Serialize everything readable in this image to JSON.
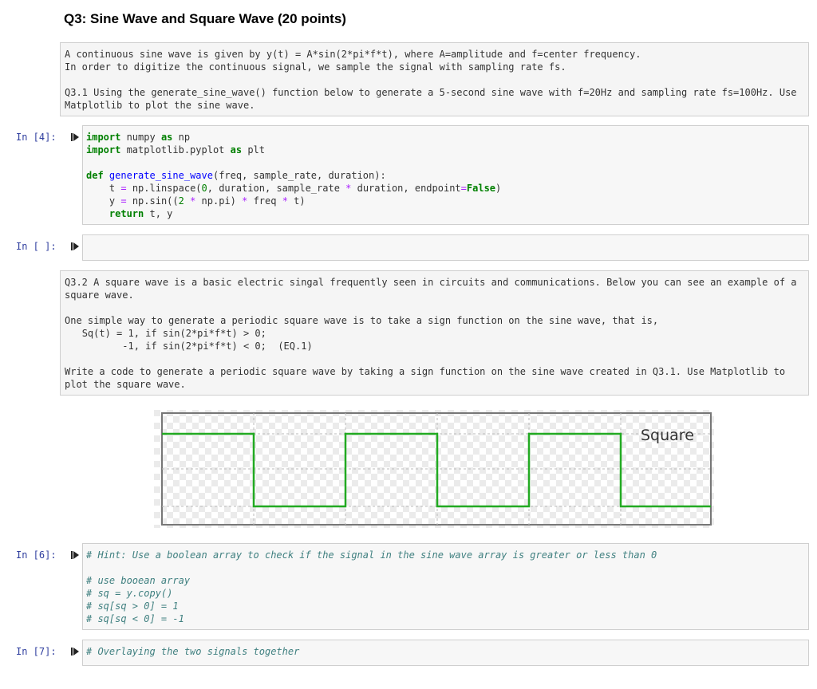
{
  "heading": "Q3: Sine Wave and Square Wave (20 points)",
  "md1": {
    "line1": "A continuous sine wave is given by y(t) = A*sin(2*pi*f*t), where A=amplitude and f=center frequency.",
    "line2": "In order to digitize the continuous signal, we sample the signal with sampling rate fs.",
    "line3": "Q3.1 Using the generate_sine_wave() function below to generate a 5-second sine wave with f=20Hz and sampling rate fs=100Hz. Use",
    "line4": "Matplotlib to plot the sine wave."
  },
  "cells": {
    "c4": {
      "prompt": "In [4]:",
      "lines": {
        "l1a": "import",
        "l1b": " numpy ",
        "l1c": "as",
        "l1d": " np",
        "l2a": "import",
        "l2b": " matplotlib.pyplot ",
        "l2c": "as",
        "l2d": " plt",
        "l4a": "def",
        "l4b": " ",
        "l4c": "generate_sine_wave",
        "l4d": "(freq, sample_rate, duration):",
        "l5a": "    t ",
        "l5b": "=",
        "l5c": " np.linspace(",
        "l5d": "0",
        "l5e": ", duration, sample_rate ",
        "l5f": "*",
        "l5g": " duration, endpoint",
        "l5h": "=",
        "l5i": "False",
        "l5j": ")",
        "l6a": "    y ",
        "l6b": "=",
        "l6c": " np.sin((",
        "l6d": "2",
        "l6e": " ",
        "l6f": "*",
        "l6g": " np.pi) ",
        "l6h": "*",
        "l6i": " freq ",
        "l6j": "*",
        "l6k": " t)",
        "l7a": "    ",
        "l7b": "return",
        "l7c": " t, y"
      }
    },
    "empty": {
      "prompt": "In [ ]:"
    },
    "c6": {
      "prompt": "In [6]:",
      "lines": [
        "# Hint: Use a boolean array to check if the signal in the sine wave array is greater or less than 0",
        "",
        "# use booean array",
        "# sq = y.copy()",
        "# sq[sq > 0] = 1",
        "# sq[sq < 0] = -1"
      ]
    },
    "c7": {
      "prompt": "In [7]:",
      "lines": [
        "# Overlaying the two signals together"
      ]
    }
  },
  "md2": {
    "line1": "Q3.2 A square wave is a basic electric singal frequently seen in circuits and communications. Below you can see an example of a",
    "line2": "square wave.",
    "line3": "One simple way to generate a periodic square wave is to take a sign function on the sine wave, that is,",
    "line4": "   Sq(t) = 1, if sin(2*pi*f*t) > 0;",
    "line5": "          -1, if sin(2*pi*f*t) < 0;  (EQ.1)",
    "line6": "Write a code to generate a periodic square wave by taking a sign function on the sine wave created in Q3.1. Use Matplotlib to",
    "line7": "plot the square wave."
  },
  "figure": {
    "label": "Square",
    "line_color": "#22aa22",
    "square_wave": [
      {
        "level": 1,
        "duration": 1
      },
      {
        "level": -1,
        "duration": 1
      },
      {
        "level": 1,
        "duration": 1
      },
      {
        "level": -1,
        "duration": 1
      },
      {
        "level": 1,
        "duration": 1
      },
      {
        "level": -1,
        "duration": 1
      }
    ]
  },
  "icons": {
    "run": "run-cell-icon"
  }
}
